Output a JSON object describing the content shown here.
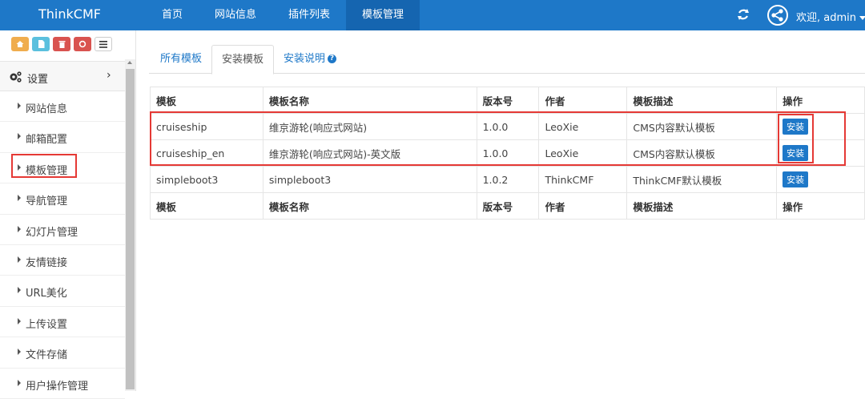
{
  "header": {
    "brand": "ThinkCMF",
    "nav": [
      {
        "label": "首页",
        "active": false
      },
      {
        "label": "网站信息",
        "active": false
      },
      {
        "label": "插件列表",
        "active": false
      },
      {
        "label": "模板管理",
        "active": true
      }
    ],
    "user_label": "欢迎, admin",
    "icons": {
      "refresh": "refresh-icon",
      "avatar": "share-avatar-icon"
    }
  },
  "sidebar": {
    "shortcut_icons": [
      "home-icon",
      "file-icon",
      "trash-icon",
      "recycle-icon",
      "list-icon"
    ],
    "settings_label": "设置",
    "items": [
      {
        "label": "网站信息"
      },
      {
        "label": "邮箱配置"
      },
      {
        "label": "模板管理",
        "highlighted": true
      },
      {
        "label": "导航管理"
      },
      {
        "label": "幻灯片管理"
      },
      {
        "label": "友情链接"
      },
      {
        "label": "URL美化"
      },
      {
        "label": "上传设置"
      },
      {
        "label": "文件存储"
      },
      {
        "label": "用户操作管理"
      }
    ]
  },
  "tabs": [
    {
      "label": "所有模板",
      "active": false
    },
    {
      "label": "安装模板",
      "active": true
    },
    {
      "label": "安装说明",
      "active": false
    }
  ],
  "table": {
    "headers": [
      "模板",
      "模板名称",
      "版本号",
      "作者",
      "模板描述",
      "操作"
    ],
    "rows": [
      {
        "template": "cruiseship",
        "name": "维京游轮(响应式网站)",
        "version": "1.0.0",
        "author": "LeoXie",
        "desc": "CMS内容默认模板",
        "action": "安装"
      },
      {
        "template": "cruiseship_en",
        "name": "维京游轮(响应式网站)-英文版",
        "version": "1.0.0",
        "author": "LeoXie",
        "desc": "CMS内容默认模板",
        "action": "安装"
      },
      {
        "template": "simpleboot3",
        "name": "simpleboot3",
        "version": "1.0.2",
        "author": "ThinkCMF",
        "desc": "ThinkCMF默认模板",
        "action": "安装"
      }
    ]
  },
  "colors": {
    "header": "#1e78c8",
    "highlight": "#e53935"
  }
}
